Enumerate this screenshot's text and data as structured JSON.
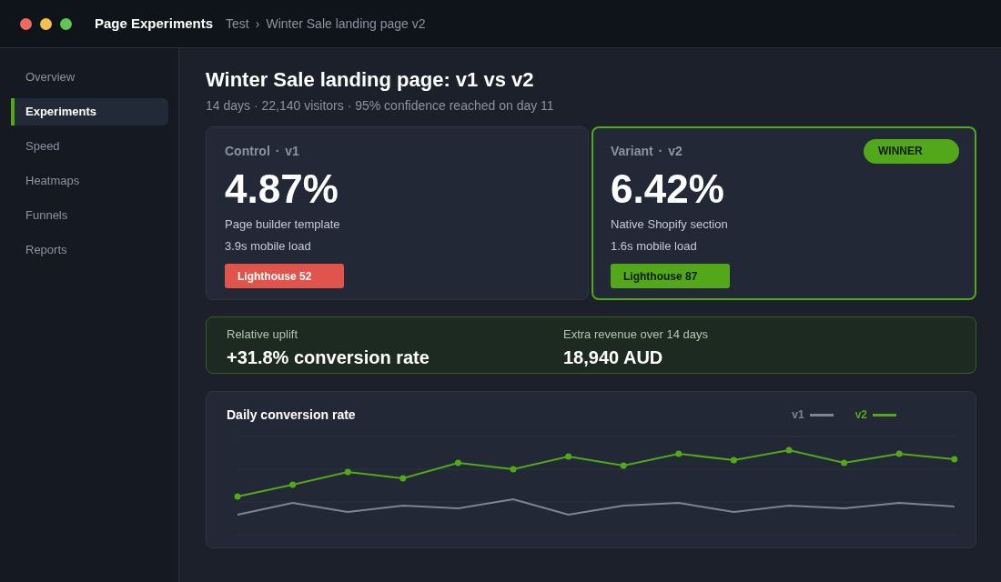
{
  "app_bar": {
    "title": "Page Experiments",
    "breadcrumb": [
      {
        "label": "Test"
      },
      {
        "label": "Winter Sale landing page v2"
      }
    ],
    "breadcrumb_separator": "›"
  },
  "sidebar": {
    "items": [
      {
        "label": "Overview",
        "selected": false
      },
      {
        "label": "Experiments",
        "selected": true
      },
      {
        "label": "Speed",
        "selected": false
      },
      {
        "label": "Heatmaps",
        "selected": false
      },
      {
        "label": "Funnels",
        "selected": false
      },
      {
        "label": "Reports",
        "selected": false
      }
    ]
  },
  "experiment": {
    "title": "Winter Sale landing page: v1 vs v2",
    "summary": "14 days · 22,140 visitors · 95% confidence reached on day 11"
  },
  "variants": [
    {
      "label": "Control · v1",
      "winner": false,
      "conversion_rate": "4.87%",
      "description": "Page builder template",
      "mobile_load": "3.9s mobile load",
      "lighthouse": {
        "label": "Lighthouse 52",
        "color": "#e0544b"
      }
    },
    {
      "label": "Variant · v2",
      "winner": true,
      "winner_badge": "WINNER",
      "conversion_rate": "6.42%",
      "description": "Native Shopify section",
      "mobile_load": "1.6s mobile load",
      "lighthouse": {
        "label": "Lighthouse 87",
        "color": "#52a818"
      }
    }
  ],
  "uplift_banner": {
    "metrics": [
      {
        "label": "Relative uplift",
        "value": "+31.8% conversion rate"
      },
      {
        "label": "Extra revenue over 14 days",
        "value": "18,940 AUD"
      }
    ]
  },
  "chart": {
    "title": "Daily conversion rate",
    "legend": [
      {
        "label": "v1",
        "color": "#7d8594"
      },
      {
        "label": "v2",
        "color": "#52a818"
      }
    ]
  }
}
